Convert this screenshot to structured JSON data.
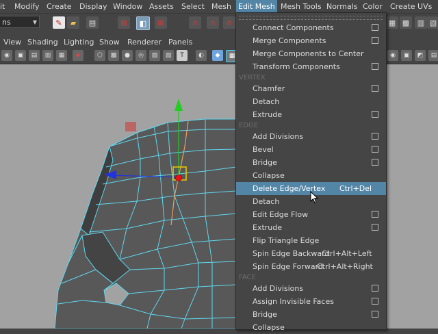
{
  "menubar": {
    "items": [
      "it",
      "Modify",
      "Create",
      "Display",
      "Window",
      "Assets",
      "Select",
      "Mesh",
      "Edit Mesh",
      "Mesh Tools",
      "Normals",
      "Color",
      "Create UVs"
    ]
  },
  "toolbar": {
    "mode_value": "ns"
  },
  "panel": {
    "items": [
      "View",
      "Shading",
      "Lighting",
      "Show",
      "Renderer",
      "Panels"
    ]
  },
  "dropdown": {
    "sections": {
      "vertex": "VERTEX",
      "edge": "EDGE",
      "face": "FACE"
    },
    "items": [
      {
        "label": "Connect Components",
        "option": true
      },
      {
        "label": "Merge Components",
        "option": true
      },
      {
        "label": "Merge Components to Center",
        "option": false
      },
      {
        "label": "Transform Components",
        "option": true
      },
      {
        "label": "Chamfer",
        "option": true
      },
      {
        "label": "Detach",
        "option": false
      },
      {
        "label": "Extrude",
        "option": true
      },
      {
        "label": "Add Divisions",
        "option": true
      },
      {
        "label": "Bevel",
        "option": true
      },
      {
        "label": "Bridge",
        "option": true
      },
      {
        "label": "Collapse",
        "option": false
      },
      {
        "label": "Delete Edge/Vertex",
        "shortcut": "Ctrl+Del",
        "highlighted": true,
        "option": false
      },
      {
        "label": "Detach",
        "option": false
      },
      {
        "label": "Edit Edge Flow",
        "option": true
      },
      {
        "label": "Extrude",
        "option": true
      },
      {
        "label": "Flip Triangle Edge",
        "option": false
      },
      {
        "label": "Spin Edge Backward",
        "shortcut": "Ctrl+Alt+Left",
        "option": false
      },
      {
        "label": "Spin Edge Forward",
        "shortcut": "Ctrl+Alt+Right",
        "option": false
      },
      {
        "label": "Add Divisions",
        "option": true
      },
      {
        "label": "Assign Invisible Faces",
        "option": true
      },
      {
        "label": "Bridge",
        "option": true
      },
      {
        "label": "Collapse",
        "option": false
      }
    ]
  },
  "colors": {
    "highlight": "#5285a6",
    "wireframe": "#5fd8f0",
    "manipulator_y": "#22cc22",
    "manipulator_x": "#2233dd",
    "selected_vertex": "#ee1111",
    "selected_edge": "#e8a060"
  },
  "icons": [
    "new-scene-icon",
    "open-scene-icon",
    "save-scene-icon",
    "select-hierarchy-icon",
    "select-object-icon",
    "select-component-icon",
    "snap-grid-icon",
    "snap-curve-icon",
    "snap-point-icon",
    "camera-icon",
    "layout-icon",
    "wireframe-icon",
    "smooth-shade-icon",
    "texture-icon",
    "light-icon",
    "xray-icon"
  ]
}
